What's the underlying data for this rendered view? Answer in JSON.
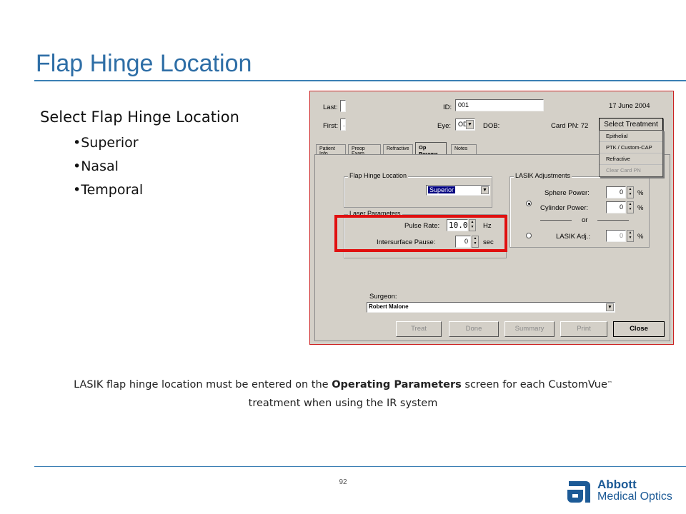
{
  "slide": {
    "title": "Flap Hinge Location",
    "page_number": "92",
    "bullets_heading": "Select Flap Hinge Location",
    "bullets": [
      "Superior",
      "Nasal",
      "Temporal"
    ],
    "caption_part1": "LASIK flap hinge location must be entered on the ",
    "caption_bold": "Operating Parameters",
    "caption_part2": " screen for each CustomVue",
    "caption_tm": "™",
    "caption_line2": "treatment when using the IR system"
  },
  "logo": {
    "line1": "Abbott",
    "line2": "Medical Optics"
  },
  "app": {
    "header": {
      "last_label": "Last:",
      "last_value": "",
      "first_label": "First:",
      "first_value": ".",
      "id_label": "ID:",
      "id_value": "001",
      "eye_label": "Eye:",
      "eye_value": "OD",
      "dob_label": "DOB:",
      "date": "17 June 2004",
      "card_pn": "Card PN: 72",
      "select_treatment": "Select Treatment"
    },
    "treatment_menu": [
      "Epithelial",
      "PTK / Custom-CAP",
      "Refractive",
      "Clear Card PN"
    ],
    "tabs": [
      "Patient Info",
      "Preop Exam",
      "Refractive",
      "Op Params",
      "Notes"
    ],
    "flap_hinge": {
      "title": "Flap Hinge Location",
      "value": "Superior"
    },
    "laser_params": {
      "title": "Laser Parameters",
      "pulse_rate_label": "Pulse Rate:",
      "pulse_rate_value": "10.0",
      "pulse_rate_unit": "Hz",
      "intersurface_label": "Intersurface Pause:",
      "intersurface_value": "0",
      "intersurface_unit": "sec"
    },
    "lasik_adj": {
      "title": "LASIK Adjustments",
      "sphere_label": "Sphere Power:",
      "sphere_value": "0",
      "sphere_unit": "%",
      "cylinder_label": "Cylinder Power:",
      "cylinder_value": "0",
      "cylinder_unit": "%",
      "or_label": "or",
      "lasik_label": "LASIK Adj.:",
      "lasik_value": "0",
      "lasik_unit": "%"
    },
    "surgeon": {
      "label": "Surgeon:",
      "value": "Robert Malone"
    },
    "buttons": {
      "treat": "Treat",
      "done": "Done",
      "summary": "Summary",
      "print": "Print",
      "close": "Close"
    }
  }
}
